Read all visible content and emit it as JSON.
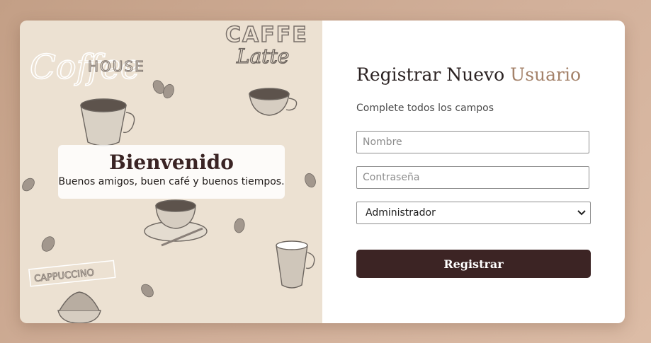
{
  "welcome": {
    "heading": "Bienvenido",
    "tagline": "Buenos amigos, buen café y buenos tiempos."
  },
  "background_text": {
    "coffee": "Coffee",
    "house": "HOUSE",
    "caffe": "CAFFE",
    "latte": "Latte",
    "cappuccino": "CAPPUCCINO"
  },
  "form": {
    "title_main": "Registrar Nuevo ",
    "title_accent": "Usuario",
    "subtitle": "Complete todos los campos",
    "name_placeholder": "Nombre",
    "password_placeholder": "Contraseña",
    "role_selected": "Administrador",
    "submit_label": "Registrar"
  },
  "colors": {
    "accent": "#a4826a",
    "button": "#3c2424",
    "panel_bg": "#ece1d2"
  }
}
